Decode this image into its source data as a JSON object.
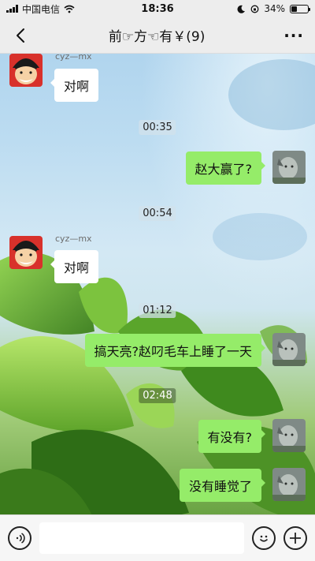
{
  "status_bar": {
    "carrier": "中国电信",
    "time": "18:36",
    "battery": "34%",
    "battery_level": 0.34
  },
  "nav": {
    "title": "前☞方☜有￥(9)",
    "more_label": "···"
  },
  "messages": [
    {
      "type": "in",
      "sender": "cyz—mx",
      "text": "对啊"
    },
    {
      "type": "time",
      "text": "00:35"
    },
    {
      "type": "out",
      "text": "赵大赢了?"
    },
    {
      "type": "time",
      "text": "00:54"
    },
    {
      "type": "in",
      "sender": "cyz—mx",
      "text": "对啊"
    },
    {
      "type": "time",
      "text": "01:12"
    },
    {
      "type": "out",
      "text": "搞天亮?赵叼毛车上睡了一天"
    },
    {
      "type": "time",
      "text": "02:48"
    },
    {
      "type": "out",
      "text": "有没有?"
    },
    {
      "type": "out",
      "text": "没有睡觉了"
    }
  ],
  "input_bar": {
    "voice_icon": "voice-icon",
    "emoji_icon": "emoji-icon",
    "add_icon": "plus-icon",
    "placeholder": ""
  },
  "colors": {
    "out_bubble": "#95ec69",
    "in_bubble": "#ffffff",
    "bar_bg": "#ededed"
  }
}
